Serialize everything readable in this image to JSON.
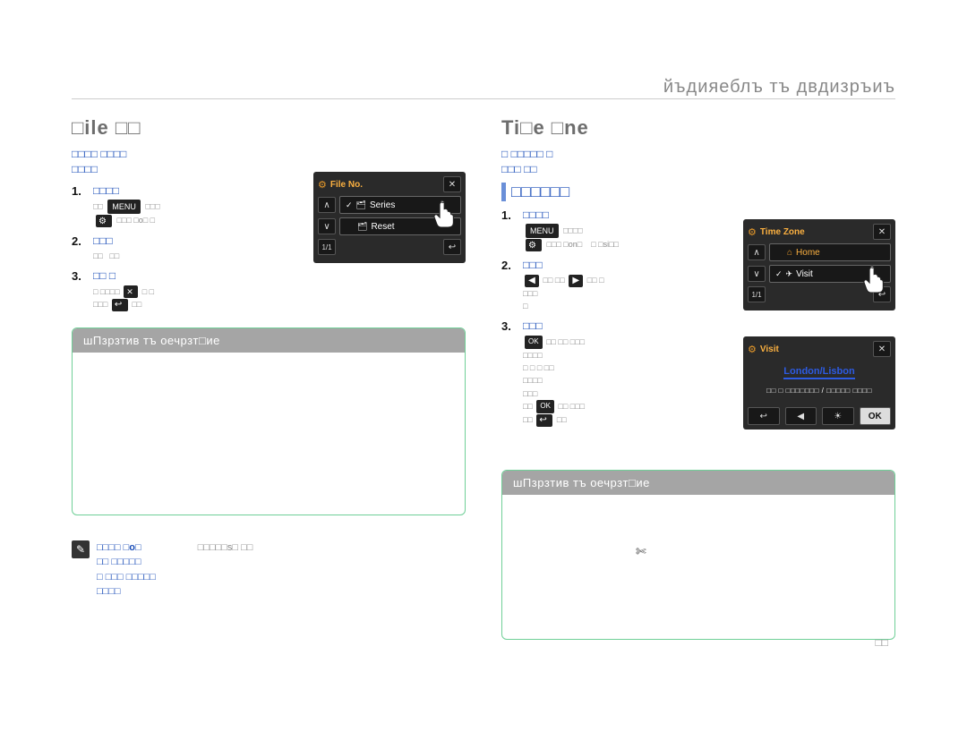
{
  "header": {
    "chapter": "йъдияеблъ тъ двдизръиъ"
  },
  "left": {
    "title": "□ile □□",
    "intro": "□□□□ □□□□\n□□□□",
    "steps": [
      {
        "num": "1.",
        "body": "□□□□",
        "sub": "□□  ■■■  □□□\n⚙  □□□ □o□  □"
      },
      {
        "num": "2.",
        "body": "□□□",
        "sub": "□□  □□"
      },
      {
        "num": "3.",
        "body": "□□ □",
        "sub": "□ □□□□  ✕ □ □\n□□□  ↩  □□"
      }
    ],
    "sub_header": "шПзрзтив тъ оечрзт□ие",
    "note": "□□□□ □o□  □□□□s□ □□\n□□ □□□□□\n□ □□□ □□□□□\n□□□□"
  },
  "right": {
    "title": "Ti□e □ne",
    "intro": "□ □□□□□ □\n□□□ □□",
    "sub_title": "□□□□□□",
    "steps": [
      {
        "num": "1.",
        "body": "□□□□",
        "sub": "■■■  □□□□\n⚙ □□□ □on□  □ □si□□"
      },
      {
        "num": "2.",
        "body": "□□□",
        "sub": "◀ □□ □□  ▶ □□ □\n□□□\n□"
      },
      {
        "num": "3.",
        "body": "□□□",
        "sub": "OK □□ □□ □□□\n□□□□\n□ □ □ □□\n□□□□\n□□□\n□□ OK □□ □□□\n□□  ↩  □□"
      }
    ],
    "sub_header": "шПзрзтив тъ оечрзт□ие"
  },
  "ui1": {
    "title": "File No.",
    "items": [
      "Series",
      "Reset"
    ]
  },
  "ui2": {
    "title": "Time Zone",
    "items": [
      "Home",
      "Visit"
    ]
  },
  "ui3": {
    "title": "Visit",
    "city": "London/Lisbon",
    "date": "□□ □ □□□□□□□ / □□□□□ □□□□",
    "ok": "OK"
  },
  "page_num": "□□"
}
